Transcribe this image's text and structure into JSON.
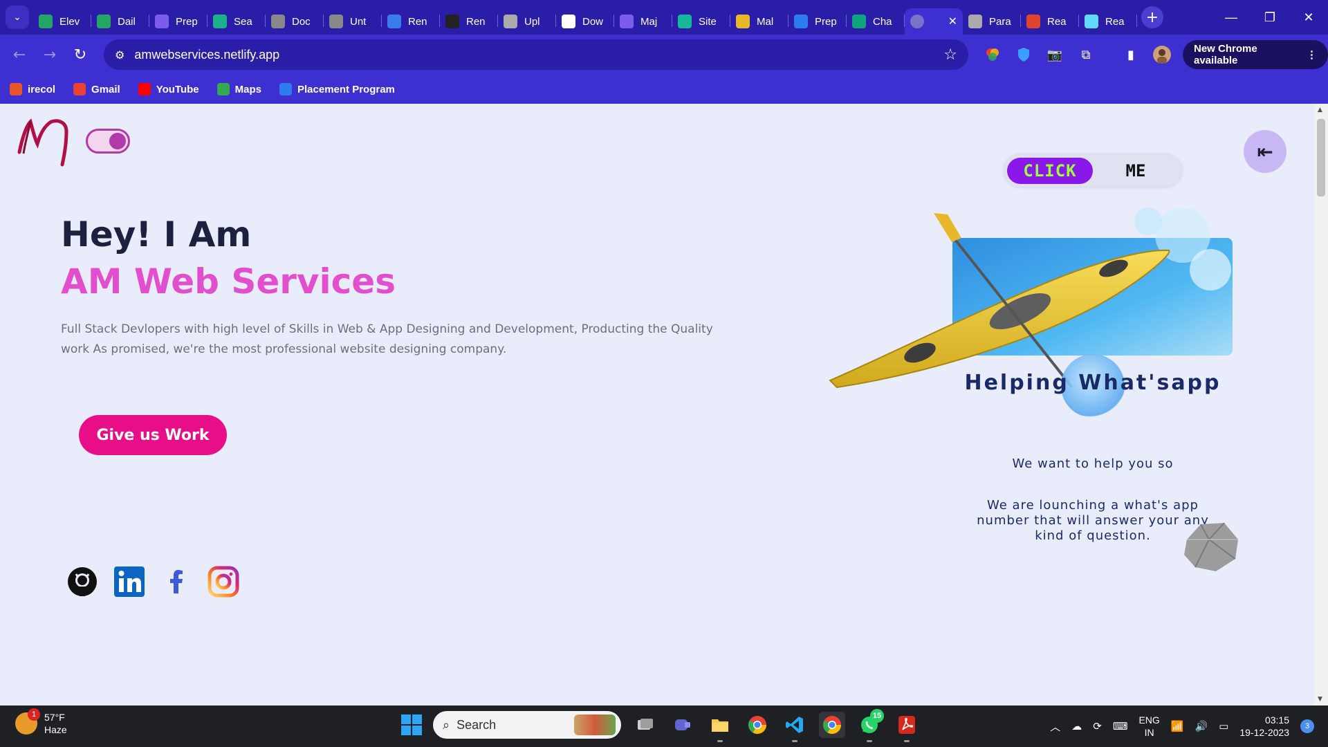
{
  "browser": {
    "tabs": [
      {
        "label": "Elev",
        "icon": "sheets-icon",
        "color": "#23a566"
      },
      {
        "label": "Dail",
        "icon": "sheets-icon",
        "color": "#23a566"
      },
      {
        "label": "Prep",
        "icon": "list-icon",
        "color": "#7b5cf0"
      },
      {
        "label": "Sea",
        "icon": "vercel-v-icon",
        "color": "#1bb28a"
      },
      {
        "label": "Doc",
        "icon": "globe-icon",
        "color": "#888888"
      },
      {
        "label": "Unt",
        "icon": "globe-icon",
        "color": "#888888"
      },
      {
        "label": "Ren",
        "icon": "render-icon",
        "color": "#3a7bf0"
      },
      {
        "label": "Ren",
        "icon": "github-icon",
        "color": "#222222"
      },
      {
        "label": "Upl",
        "icon": "layers-icon",
        "color": "#aaaaaa"
      },
      {
        "label": "Dow",
        "icon": "download-icon",
        "color": "#ffffff"
      },
      {
        "label": "Maj",
        "icon": "list-icon",
        "color": "#7b5cf0"
      },
      {
        "label": "Site",
        "icon": "diamond-icon",
        "color": "#17b899"
      },
      {
        "label": "Mal",
        "icon": "smiley-icon",
        "color": "#e6b82a"
      },
      {
        "label": "Prep",
        "icon": "pb-icon",
        "color": "#2f7cf0"
      },
      {
        "label": "Cha",
        "icon": "chatgpt-icon",
        "color": "#10a37f"
      }
    ],
    "active_tab": {
      "icon": "globe-icon"
    },
    "tabs_after": [
      {
        "label": "Para",
        "icon": "pin-icon",
        "color": "#aaaaaa"
      },
      {
        "label": "Rea",
        "icon": "flag-icon",
        "color": "#e0442e"
      },
      {
        "label": "Rea",
        "icon": "react-icon",
        "color": "#61dafb"
      }
    ],
    "url": "amwebservices.netlify.app",
    "new_chrome_label": "New Chrome available",
    "bookmarks": [
      {
        "label": "irecol",
        "icon": "irecol-icon",
        "color": "#e8552a"
      },
      {
        "label": "Gmail",
        "icon": "gmail-icon",
        "color": "#ea4335"
      },
      {
        "label": "YouTube",
        "icon": "youtube-icon",
        "color": "#ff0000"
      },
      {
        "label": "Maps",
        "icon": "maps-icon",
        "color": "#34a853"
      },
      {
        "label": "Placement Program",
        "icon": "pb-icon",
        "color": "#2f7cf0"
      }
    ]
  },
  "page": {
    "hero_greeting": "Hey! I Am",
    "hero_name": "AM Web Services",
    "hero_description": "Full Stack Devlopers with high level of Skills in Web & App Designing and Development, Producting the Quality work As promised, we're the most professional website designing company.",
    "cta_label": "Give us Work",
    "click_label": "CLICK",
    "me_label": "ME",
    "whatsapp_heading": "Helping What'sapp",
    "whatsapp_sub": "We want to help you so",
    "whatsapp_desc": "We are lounching a what's app number that will answer your any kind of question.",
    "socials": [
      "github-icon",
      "linkedin-icon",
      "facebook-icon",
      "instagram-icon"
    ],
    "colors": {
      "accent_pink": "#e24fce",
      "cta": "#e80e87",
      "heading": "#1e2040",
      "toggle": "#b23aa8"
    }
  },
  "taskbar": {
    "temp": "57°F",
    "weather": "Haze",
    "weather_badge": "1",
    "search_placeholder": "Search",
    "whatsapp_badge": "15",
    "lang_line1": "ENG",
    "lang_line2": "IN",
    "time": "03:15",
    "date": "19-12-2023",
    "notification_count": "3"
  }
}
